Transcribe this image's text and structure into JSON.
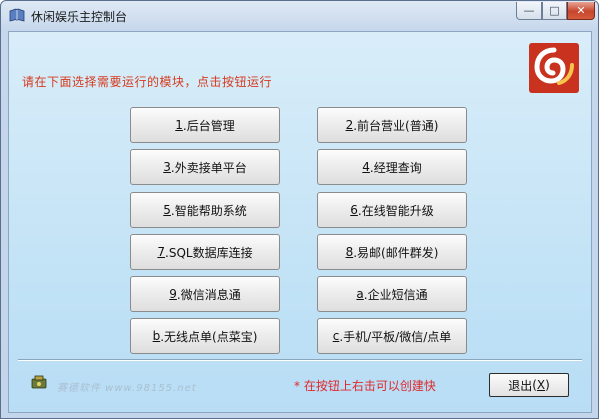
{
  "window": {
    "title": "休闲娱乐主控制台",
    "min_glyph": "—",
    "max_glyph": "□",
    "close_glyph": "✕"
  },
  "instruction": "请在下面选择需要运行的模块，点击按钮运行",
  "buttons": [
    {
      "key": "1",
      "label": ".后台管理"
    },
    {
      "key": "2",
      "label": ".前台营业(普通)"
    },
    {
      "key": "3",
      "label": ".外卖接单平台"
    },
    {
      "key": "4",
      "label": ".经理查询"
    },
    {
      "key": "5",
      "label": ".智能帮助系统"
    },
    {
      "key": "6",
      "label": ".在线智能升级"
    },
    {
      "key": "7",
      "label": ".SQL数据库连接"
    },
    {
      "key": "8",
      "label": ".易邮(邮件群发)"
    },
    {
      "key": "9",
      "label": ".微信消息通"
    },
    {
      "key": "a",
      "label": ".企业短信通"
    },
    {
      "key": "b",
      "label": ".无线点单(点菜宝)"
    },
    {
      "key": "c",
      "label": ".手机/平板/微信/点单"
    }
  ],
  "footer": {
    "watermark": "赛德软件 www.98155.net",
    "hint": "* 在按钮上右击可以创建快",
    "exit_key": "X",
    "exit_label": "退出"
  },
  "colors": {
    "instruction": "#d63a1e",
    "hint": "#e0282a",
    "logo": "#c8321e"
  }
}
